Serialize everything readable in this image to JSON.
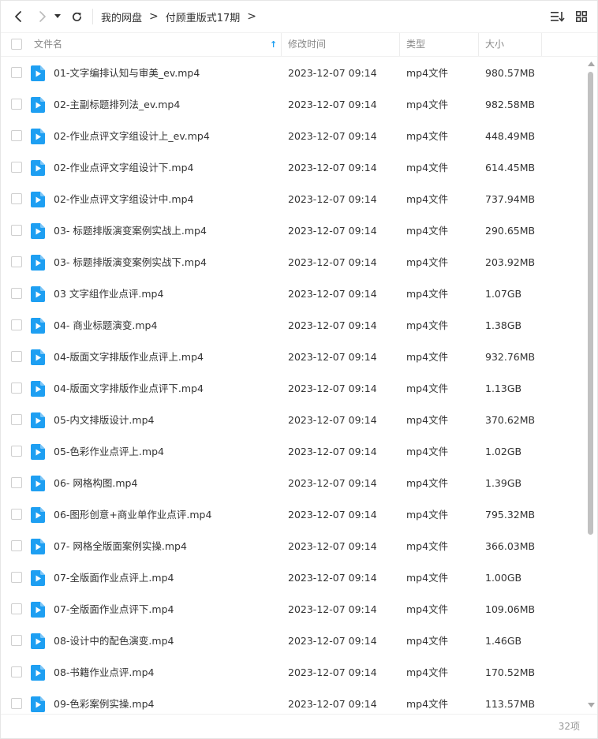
{
  "colors": {
    "accent": "#1e9ff2",
    "sort_arrow": "#1e9ff2",
    "text": "#333333",
    "muted": "#888888"
  },
  "toolbar": {
    "back_icon": "chevron-left-icon",
    "forward_icon": "chevron-right-icon",
    "history_icon": "caret-down-icon",
    "refresh_icon": "refresh-icon",
    "sort_icon": "sort-list-icon",
    "view_icon": "grid-view-icon"
  },
  "breadcrumb": {
    "items": [
      "我的网盘",
      "付顾重版式17期"
    ],
    "separator": ">"
  },
  "columns": {
    "name": "文件名",
    "time": "修改时间",
    "type": "类型",
    "size": "大小",
    "sort_indicator": "↑"
  },
  "files": [
    {
      "name": "01-文字编排认知与审美_ev.mp4",
      "time": "2023-12-07 09:14",
      "type": "mp4文件",
      "size": "980.57MB"
    },
    {
      "name": "02-主副标题排列法_ev.mp4",
      "time": "2023-12-07 09:14",
      "type": "mp4文件",
      "size": "982.58MB"
    },
    {
      "name": "02-作业点评文字组设计上_ev.mp4",
      "time": "2023-12-07 09:14",
      "type": "mp4文件",
      "size": "448.49MB"
    },
    {
      "name": "02-作业点评文字组设计下.mp4",
      "time": "2023-12-07 09:14",
      "type": "mp4文件",
      "size": "614.45MB"
    },
    {
      "name": "02-作业点评文字组设计中.mp4",
      "time": "2023-12-07 09:14",
      "type": "mp4文件",
      "size": "737.94MB"
    },
    {
      "name": "03- 标题排版演变案例实战上.mp4",
      "time": "2023-12-07 09:14",
      "type": "mp4文件",
      "size": "290.65MB"
    },
    {
      "name": "03- 标题排版演变案例实战下.mp4",
      "time": "2023-12-07 09:14",
      "type": "mp4文件",
      "size": "203.92MB"
    },
    {
      "name": "03 文字组作业点评.mp4",
      "time": "2023-12-07 09:14",
      "type": "mp4文件",
      "size": "1.07GB"
    },
    {
      "name": "04- 商业标题演变.mp4",
      "time": "2023-12-07 09:14",
      "type": "mp4文件",
      "size": "1.38GB"
    },
    {
      "name": "04-版面文字排版作业点评上.mp4",
      "time": "2023-12-07 09:14",
      "type": "mp4文件",
      "size": "932.76MB"
    },
    {
      "name": "04-版面文字排版作业点评下.mp4",
      "time": "2023-12-07 09:14",
      "type": "mp4文件",
      "size": "1.13GB"
    },
    {
      "name": "05-内文排版设计.mp4",
      "time": "2023-12-07 09:14",
      "type": "mp4文件",
      "size": "370.62MB"
    },
    {
      "name": "05-色彩作业点评上.mp4",
      "time": "2023-12-07 09:14",
      "type": "mp4文件",
      "size": "1.02GB"
    },
    {
      "name": "06- 网格构图.mp4",
      "time": "2023-12-07 09:14",
      "type": "mp4文件",
      "size": "1.39GB"
    },
    {
      "name": "06-图形创意+商业单作业点评.mp4",
      "time": "2023-12-07 09:14",
      "type": "mp4文件",
      "size": "795.32MB"
    },
    {
      "name": "07- 网格全版面案例实操.mp4",
      "time": "2023-12-07 09:14",
      "type": "mp4文件",
      "size": "366.03MB"
    },
    {
      "name": "07-全版面作业点评上.mp4",
      "time": "2023-12-07 09:14",
      "type": "mp4文件",
      "size": "1.00GB"
    },
    {
      "name": "07-全版面作业点评下.mp4",
      "time": "2023-12-07 09:14",
      "type": "mp4文件",
      "size": "109.06MB"
    },
    {
      "name": "08-设计中的配色演变.mp4",
      "time": "2023-12-07 09:14",
      "type": "mp4文件",
      "size": "1.46GB"
    },
    {
      "name": "08-书籍作业点评.mp4",
      "time": "2023-12-07 09:14",
      "type": "mp4文件",
      "size": "170.52MB"
    },
    {
      "name": "09-色彩案例实操.mp4",
      "time": "2023-12-07 09:14",
      "type": "mp4文件",
      "size": "113.57MB"
    }
  ],
  "file_icon": "video-file-icon",
  "footer": {
    "count": "32项"
  }
}
